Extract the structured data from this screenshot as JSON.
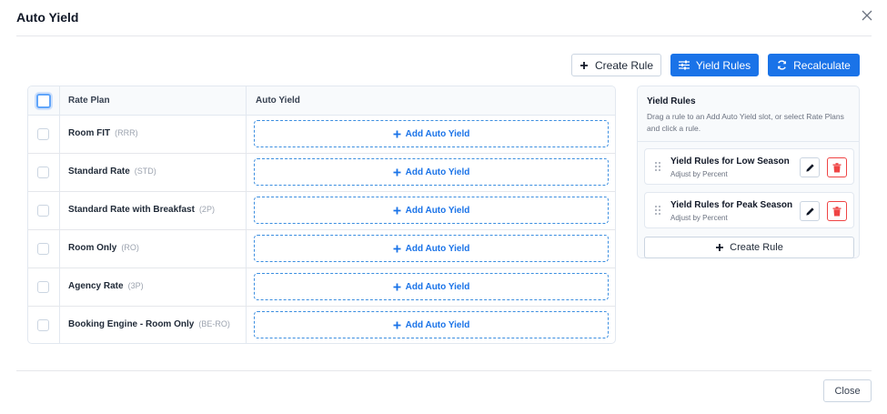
{
  "modal": {
    "title": "Auto Yield"
  },
  "toolbar": {
    "create_rule_label": "Create Rule",
    "yield_rules_label": "Yield Rules",
    "recalculate_label": "Recalculate"
  },
  "table": {
    "columns": [
      "Rate Plan",
      "Auto Yield"
    ],
    "add_label": "Add Auto Yield",
    "rows": [
      {
        "name": "Room FIT",
        "code": "(RRR)"
      },
      {
        "name": "Standard Rate",
        "code": "(STD)"
      },
      {
        "name": "Standard Rate with Breakfast",
        "code": "(2P)"
      },
      {
        "name": "Room Only",
        "code": "(RO)"
      },
      {
        "name": "Agency Rate",
        "code": "(3P)"
      },
      {
        "name": "Booking Engine - Room Only",
        "code": "(BE-RO)"
      }
    ]
  },
  "panel": {
    "title": "Yield Rules",
    "description": "Drag a rule to an Add Auto Yield slot, or select Rate Plans and click a rule.",
    "rules": [
      {
        "name": "Yield Rules for Low Season",
        "sub": "Adjust by Percent"
      },
      {
        "name": "Yield Rules for Peak Season",
        "sub": "Adjust by Percent"
      }
    ],
    "create_label": "Create Rule"
  },
  "footer": {
    "close_label": "Close"
  },
  "colors": {
    "primary": "#1a73e8",
    "danger": "#ef4444",
    "border": "#e2e8f0"
  },
  "icons": [
    "close-icon",
    "plus-icon",
    "sliders-icon",
    "refresh-icon",
    "drag-handle-icon",
    "pencil-icon",
    "trash-icon"
  ]
}
